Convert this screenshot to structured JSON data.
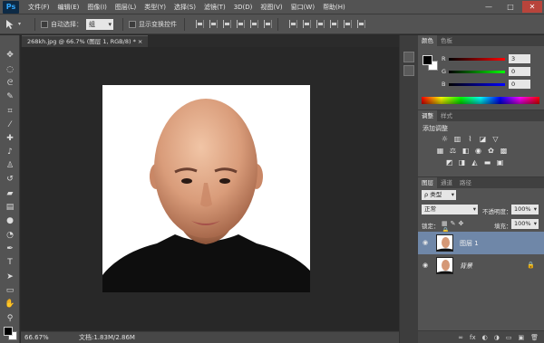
{
  "app": {
    "logo": "Ps"
  },
  "menu": [
    "文件(F)",
    "编辑(E)",
    "图像(I)",
    "图层(L)",
    "类型(Y)",
    "选择(S)",
    "滤镜(T)",
    "3D(D)",
    "视图(V)",
    "窗口(W)",
    "帮助(H)"
  ],
  "window_controls": [
    "—",
    "□",
    "✕"
  ],
  "options": {
    "tool_icon": "move-tool-icon",
    "auto_select_label": "自动选择：",
    "auto_select_value": "组",
    "show_transform_label": "显示变换控件"
  },
  "document": {
    "tab_title": "268kh.jpg @ 66.7% (图层 1, RGB/8) * ×",
    "zoom": "66.67%",
    "doc_info": "文档:1.83M/2.86M"
  },
  "color_panel": {
    "tabs": [
      "颜色",
      "色板"
    ],
    "sliders": [
      {
        "label": "R",
        "value": "3",
        "color": "#e04040"
      },
      {
        "label": "G",
        "value": "0",
        "color": "#40c040"
      },
      {
        "label": "B",
        "value": "0",
        "color": "#4060e0"
      }
    ]
  },
  "adjustments": {
    "tabs": [
      "调整",
      "样式"
    ],
    "title": "添加调整"
  },
  "layers": {
    "tabs": [
      "图层",
      "通道",
      "路径"
    ],
    "filter_label": "ρ 类型",
    "blend_mode": "正常",
    "opacity_label": "不透明度：",
    "opacity_value": "100%",
    "lock_label": "锁定：",
    "fill_label": "填充：",
    "fill_value": "100%",
    "items": [
      {
        "name": "图层 1",
        "selected": true,
        "locked": false
      },
      {
        "name": "背景",
        "selected": false,
        "locked": true
      }
    ],
    "footer_icons": [
      "∞",
      "fx",
      "◐",
      "◑",
      "▭",
      "▣",
      "🗑"
    ]
  }
}
